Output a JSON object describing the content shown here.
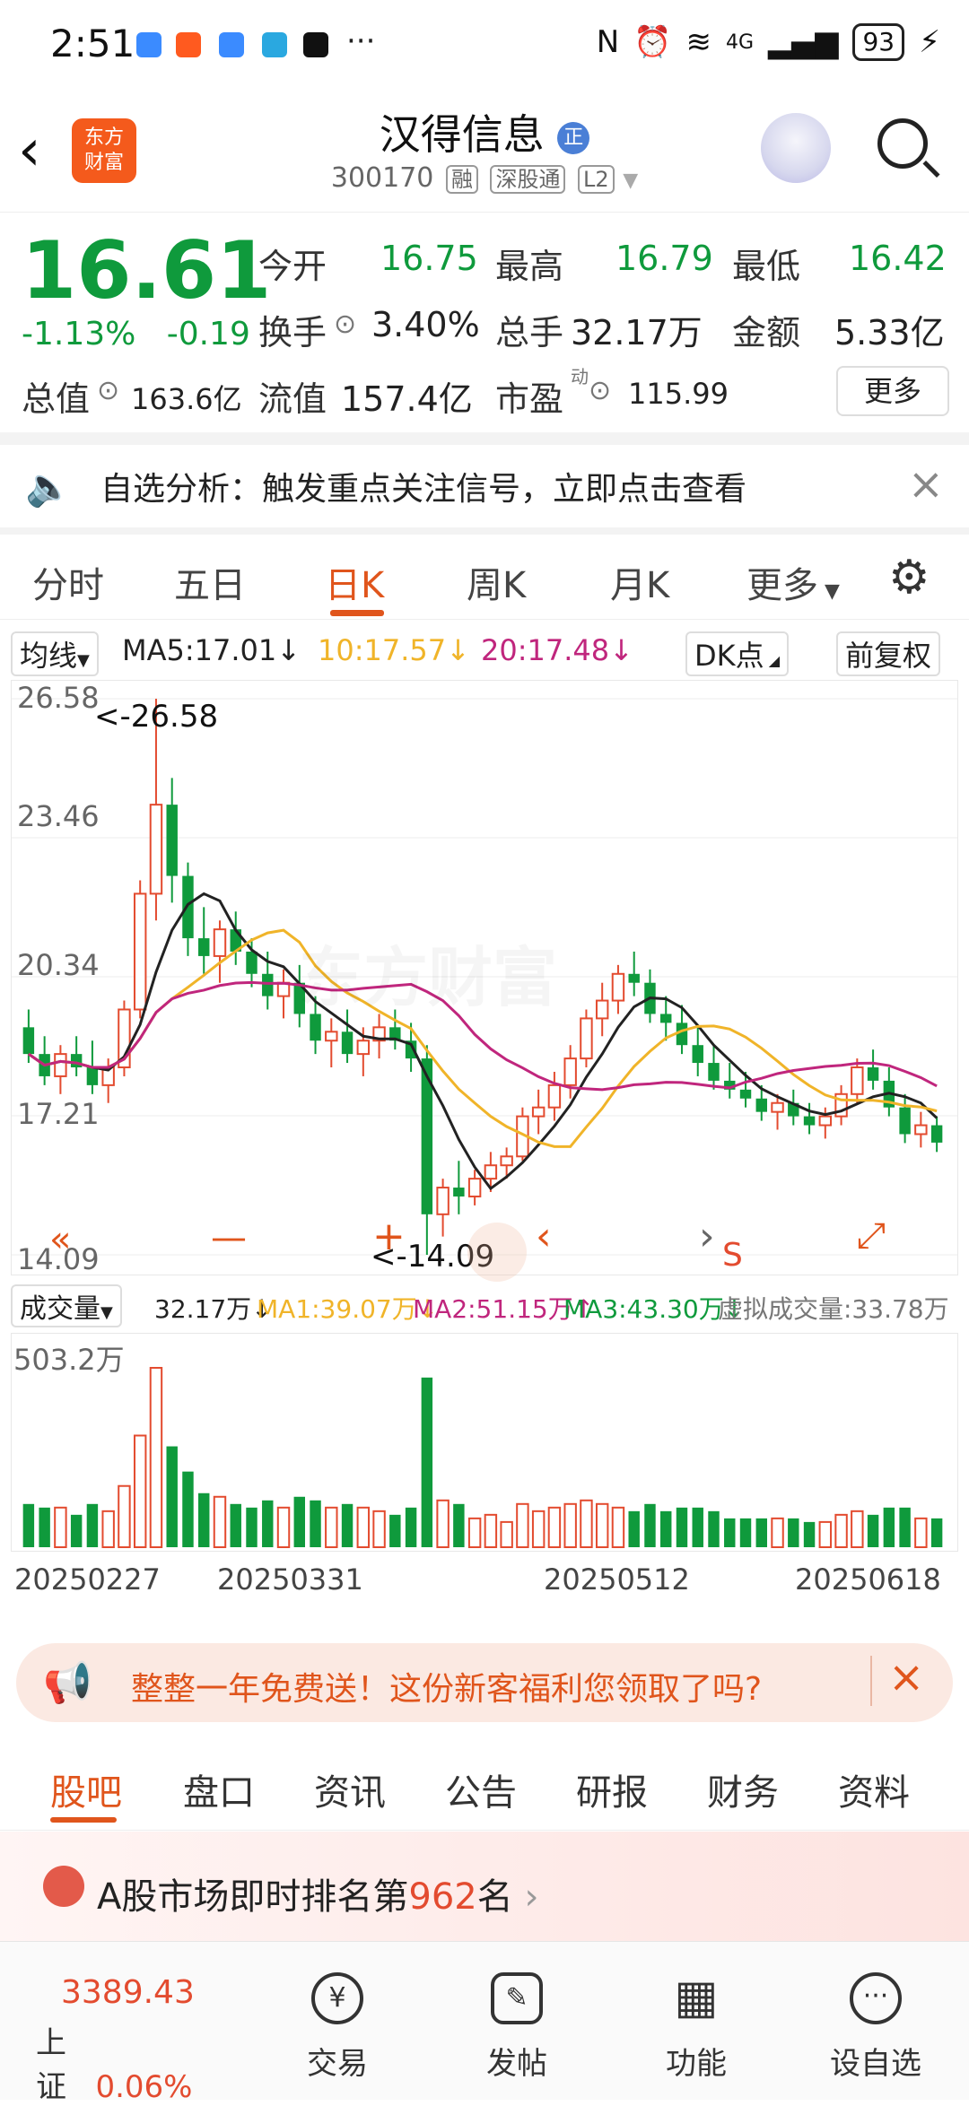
{
  "status_bar": {
    "time": "2:51",
    "network": "4G",
    "battery": "93",
    "more": "···"
  },
  "header": {
    "back_icon": "‹",
    "logo_line1": "东方",
    "logo_line2": "财富",
    "stock_name": "汉得信息",
    "badge": "正",
    "stock_code": "300170",
    "tags": [
      "融",
      "深股通",
      "L2"
    ]
  },
  "quote": {
    "price": "16.61",
    "change_pct": "-1.13%",
    "change_abs": "-0.19",
    "open_label": "今开",
    "open_value": "16.75",
    "high_label": "最高",
    "high_value": "16.79",
    "low_label": "最低",
    "low_value": "16.42",
    "turnover_label": "换手",
    "turnover_value": "3.40%",
    "volume_label": "总手",
    "volume_value": "32.17万",
    "amount_label": "金额",
    "amount_value": "5.33亿",
    "mktcap_label": "总值",
    "mktcap_value": "163.6亿",
    "float_label": "流值",
    "float_value": "157.4亿",
    "pe_label": "市盈",
    "pe_sup": "动",
    "pe_value": "115.99",
    "more_label": "更多"
  },
  "analysis_banner": {
    "text": "自选分析：触发重点关注信号，立即点击查看",
    "close": "×"
  },
  "period_tabs": {
    "items": [
      "分时",
      "五日",
      "日K",
      "周K",
      "月K",
      "更多"
    ],
    "active": "日K"
  },
  "ma_bar": {
    "selector": "均线",
    "ma5": "MA5:17.01",
    "ma10": "10:17.57",
    "ma20": "20:17.48",
    "dk": "DK点",
    "adjust": "前复权"
  },
  "kline": {
    "y_labels": [
      "26.58",
      "23.46",
      "20.34",
      "17.21",
      "14.09"
    ],
    "max_marker": "<-26.58",
    "min_marker": "<-14.09",
    "watermark": "东方财富",
    "controls": [
      "«",
      "—",
      "+",
      "‹",
      "›"
    ],
    "signal_s": "S"
  },
  "volume_bar": {
    "selector": "成交量",
    "value": "32.17万",
    "ma1": "MA1:39.07万",
    "ma2": "MA2:51.15万",
    "ma3": "MA3:43.30万",
    "virtual": "虚拟成交量:33.78万",
    "max_label": "503.2万"
  },
  "dates": [
    "20250227",
    "20250331",
    "20250512",
    "20250618"
  ],
  "colors": {
    "up": "#e34b2f",
    "down": "#0f9a3c",
    "ma5": "#222222",
    "ma10": "#f0b429",
    "ma20": "#c0267d",
    "accent": "#e0551c"
  },
  "chart_data": {
    "type": "candlestick",
    "ylim": [
      14.09,
      26.58
    ],
    "candles": [
      [
        19.2,
        19.6,
        18.4,
        18.6
      ],
      [
        18.6,
        19.0,
        17.9,
        18.1
      ],
      [
        18.1,
        18.8,
        17.7,
        18.6
      ],
      [
        18.6,
        19.0,
        18.1,
        18.3
      ],
      [
        18.3,
        18.9,
        17.7,
        17.9
      ],
      [
        17.9,
        18.5,
        17.5,
        18.3
      ],
      [
        18.3,
        19.8,
        18.1,
        19.6
      ],
      [
        19.6,
        22.5,
        19.4,
        22.2
      ],
      [
        22.2,
        26.58,
        21.6,
        24.2
      ],
      [
        24.2,
        24.8,
        22.0,
        22.6
      ],
      [
        22.6,
        22.9,
        20.8,
        21.2
      ],
      [
        21.2,
        21.9,
        20.4,
        20.8
      ],
      [
        20.8,
        21.6,
        20.2,
        21.4
      ],
      [
        21.4,
        21.8,
        20.6,
        20.9
      ],
      [
        20.9,
        21.2,
        20.1,
        20.4
      ],
      [
        20.4,
        20.9,
        19.6,
        19.9
      ],
      [
        19.9,
        20.5,
        19.4,
        20.2
      ],
      [
        20.2,
        20.6,
        19.2,
        19.5
      ],
      [
        19.5,
        19.9,
        18.6,
        18.9
      ],
      [
        18.9,
        19.4,
        18.3,
        19.1
      ],
      [
        19.1,
        19.6,
        18.4,
        18.6
      ],
      [
        18.6,
        19.2,
        18.1,
        18.9
      ],
      [
        18.9,
        19.5,
        18.5,
        19.2
      ],
      [
        19.2,
        19.6,
        18.7,
        18.9
      ],
      [
        18.9,
        19.3,
        18.2,
        18.5
      ],
      [
        18.5,
        18.8,
        14.09,
        15.0
      ],
      [
        15.0,
        15.8,
        14.5,
        15.6
      ],
      [
        15.6,
        16.2,
        15.0,
        15.4
      ],
      [
        15.4,
        16.0,
        15.2,
        15.8
      ],
      [
        15.8,
        16.4,
        15.5,
        16.1
      ],
      [
        16.1,
        16.5,
        15.8,
        16.3
      ],
      [
        16.3,
        17.4,
        16.2,
        17.2
      ],
      [
        17.2,
        17.8,
        16.8,
        17.4
      ],
      [
        17.4,
        18.2,
        17.1,
        17.9
      ],
      [
        17.9,
        18.8,
        17.6,
        18.5
      ],
      [
        18.5,
        19.6,
        18.3,
        19.4
      ],
      [
        19.4,
        20.2,
        19.0,
        19.8
      ],
      [
        19.8,
        20.6,
        19.5,
        20.4
      ],
      [
        20.4,
        20.9,
        19.9,
        20.2
      ],
      [
        20.2,
        20.5,
        19.3,
        19.5
      ],
      [
        19.5,
        19.9,
        18.9,
        19.3
      ],
      [
        19.3,
        19.7,
        18.6,
        18.8
      ],
      [
        18.8,
        19.2,
        18.1,
        18.4
      ],
      [
        18.4,
        18.8,
        17.8,
        18.0
      ],
      [
        18.0,
        18.4,
        17.6,
        17.8
      ],
      [
        17.8,
        18.2,
        17.4,
        17.6
      ],
      [
        17.6,
        17.9,
        17.1,
        17.3
      ],
      [
        17.3,
        17.7,
        16.9,
        17.5
      ],
      [
        17.5,
        17.8,
        17.0,
        17.2
      ],
      [
        17.2,
        17.5,
        16.8,
        17.0
      ],
      [
        17.0,
        17.4,
        16.7,
        17.2
      ],
      [
        17.2,
        17.9,
        17.0,
        17.7
      ],
      [
        17.7,
        18.5,
        17.5,
        18.3
      ],
      [
        18.3,
        18.7,
        17.8,
        18.0
      ],
      [
        18.0,
        18.3,
        17.2,
        17.4
      ],
      [
        17.4,
        17.7,
        16.6,
        16.8
      ],
      [
        16.8,
        17.3,
        16.5,
        17.0
      ],
      [
        17.0,
        17.2,
        16.4,
        16.61
      ]
    ]
  }
}
